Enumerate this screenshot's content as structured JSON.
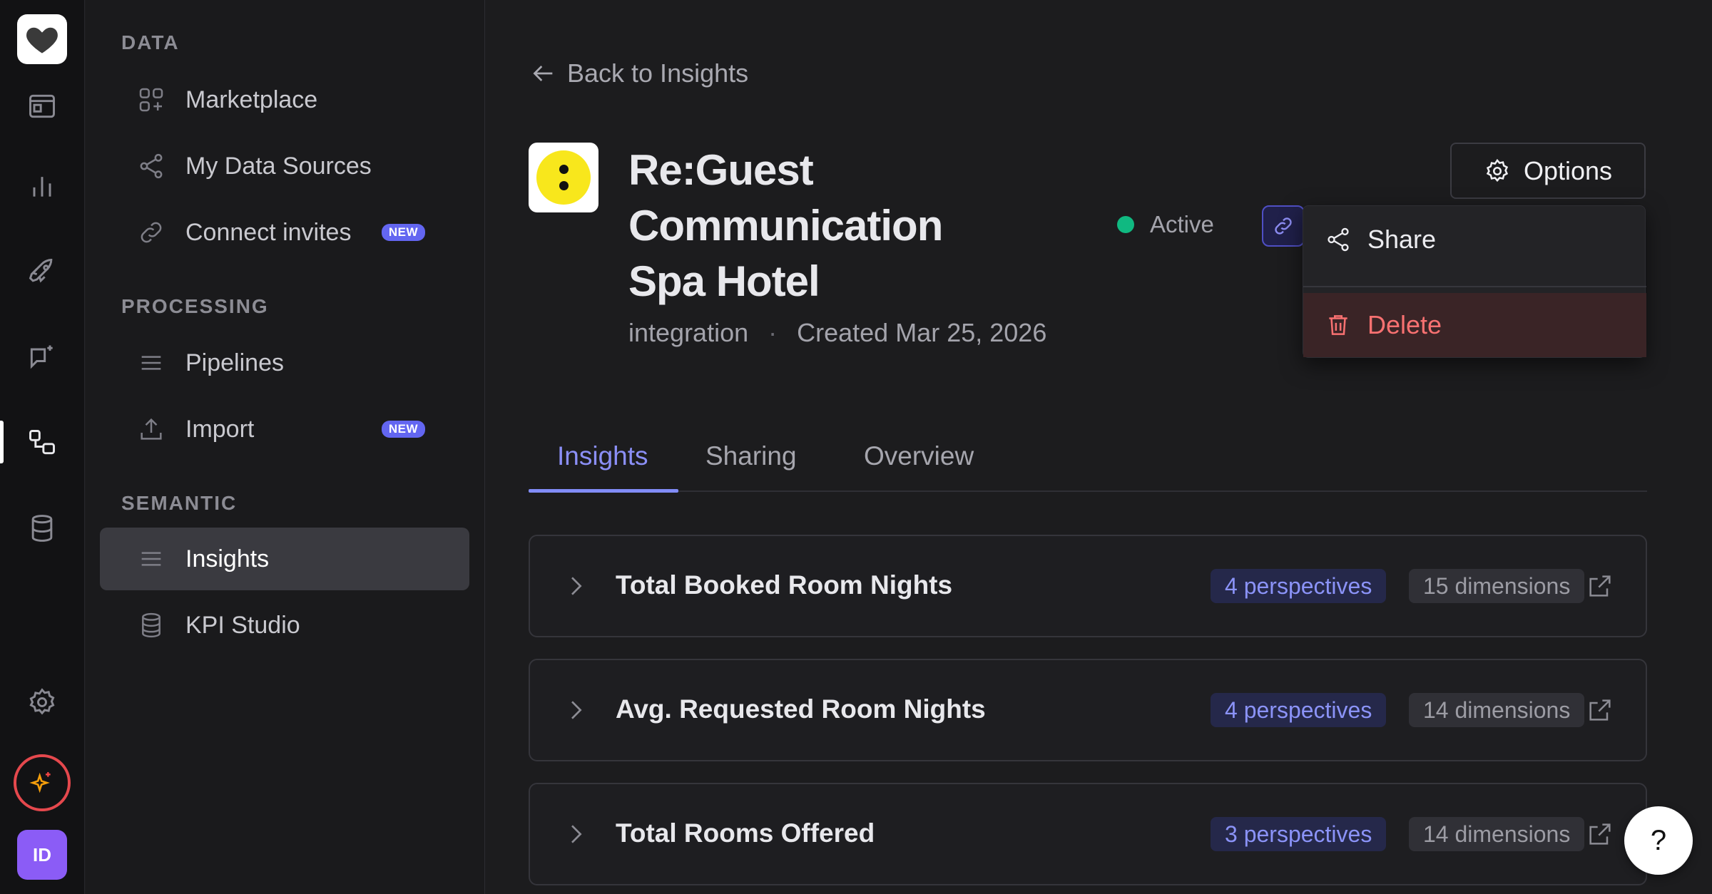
{
  "rail": {
    "avatar_initials": "ID",
    "icons": [
      "heart-logo-icon",
      "window-icon",
      "bar-chart-icon",
      "rocket-icon",
      "chat-sparkle-icon",
      "flow-icon",
      "database-icon",
      "gear-icon",
      "sparkle-icon"
    ],
    "ai_ring_color": "#e5484d",
    "avatar_color": "#8b5cf6"
  },
  "nav": {
    "sections": {
      "data": "DATA",
      "processing": "PROCESSING",
      "semantic": "SEMANTIC"
    },
    "items": [
      {
        "label": "Marketplace",
        "icon": "grid-plus-icon"
      },
      {
        "label": "My Data Sources",
        "icon": "share-nodes-icon"
      },
      {
        "label": "Connect invites",
        "icon": "link-icon",
        "badge": "NEW"
      },
      {
        "label": "Pipelines",
        "icon": "lines-icon"
      },
      {
        "label": "Import",
        "icon": "upload-icon",
        "badge": "NEW"
      },
      {
        "label": "Insights",
        "icon": "lines-icon",
        "active": true
      },
      {
        "label": "KPI Studio",
        "icon": "database-icon"
      }
    ]
  },
  "main": {
    "back_label": "Back to Insights",
    "entity": {
      "title": "Re:Guest Communication Spa Hotel",
      "type": "integration",
      "created": "Created Mar 25, 2026",
      "status": "Active",
      "status_color": "#10b981"
    },
    "options_label": "Options",
    "menu": {
      "share_label": "Share",
      "delete_label": "Delete",
      "delete_color": "#f87171"
    },
    "tabs": [
      {
        "label": "Insights",
        "active": true
      },
      {
        "label": "Sharing"
      },
      {
        "label": "Overview"
      }
    ],
    "accent_color": "#818cf8",
    "insights": [
      {
        "title": "Total Booked Room Nights",
        "perspectives": "4 perspectives",
        "dimensions": "15 dimensions"
      },
      {
        "title": "Avg. Requested Room Nights",
        "perspectives": "4 perspectives",
        "dimensions": "14 dimensions"
      },
      {
        "title": "Total Rooms Offered",
        "perspectives": "3 perspectives",
        "dimensions": "14 dimensions"
      }
    ]
  },
  "help_label": "?"
}
